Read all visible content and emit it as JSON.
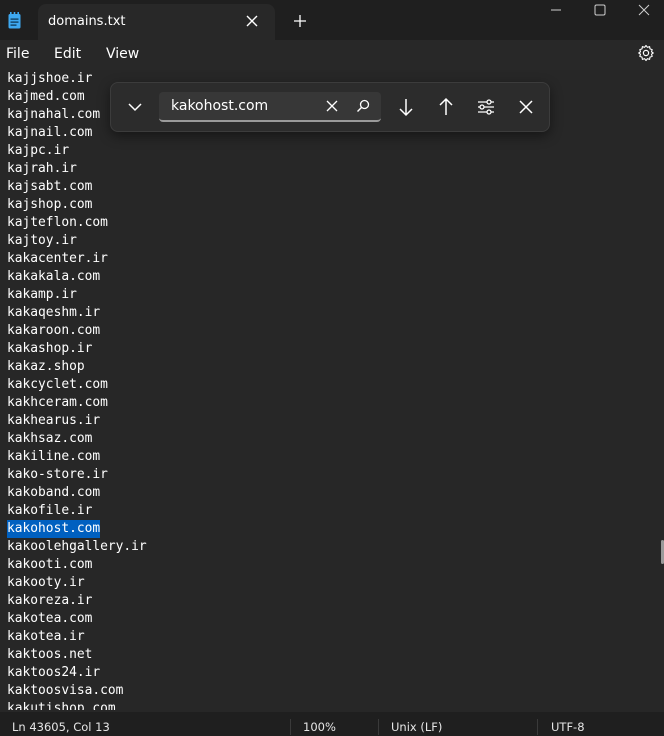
{
  "window": {
    "tab_title": "domains.txt",
    "minimize_label": "Minimize",
    "maximize_label": "Maximize",
    "close_label": "Close"
  },
  "menu": {
    "file": "File",
    "edit": "Edit",
    "view": "View"
  },
  "find": {
    "query": "kakohost.com"
  },
  "lines": [
    "kajjshoe.ir",
    "kajmed.com",
    "kajnahal.com",
    "kajnail.com",
    "kajpc.ir",
    "kajrah.ir",
    "kajsabt.com",
    "kajshop.com",
    "kajteflon.com",
    "kajtoy.ir",
    "kakacenter.ir",
    "kakakala.com",
    "kakamp.ir",
    "kakaqeshm.ir",
    "kakaroon.com",
    "kakashop.ir",
    "kakaz.shop",
    "kakcyclet.com",
    "kakhceram.com",
    "kakhearus.ir",
    "kakhsaz.com",
    "kakiline.com",
    "kako-store.ir",
    "kakoband.com",
    "kakofile.ir",
    "kakohost.com",
    "kakoolehgallery.ir",
    "kakooti.com",
    "kakooty.ir",
    "kakoreza.ir",
    "kakotea.com",
    "kakotea.ir",
    "kaktoos.net",
    "kaktoos24.ir",
    "kaktoosvisa.com",
    "kakutishop.com"
  ],
  "selected_line_index": 25,
  "status": {
    "position": "Ln 43605, Col 13",
    "zoom": "100%",
    "line_ending": "Unix (LF)",
    "encoding": "UTF-8"
  },
  "colors": {
    "background": "#272727",
    "selection": "#0060c0",
    "text": "#ffffff"
  },
  "icons": [
    "notepad-icon",
    "close-icon",
    "plus-icon",
    "minimize-icon",
    "maximize-icon",
    "settings-icon",
    "chevron-down-icon",
    "search-icon",
    "arrow-down-icon",
    "arrow-up-icon",
    "options-icon"
  ]
}
